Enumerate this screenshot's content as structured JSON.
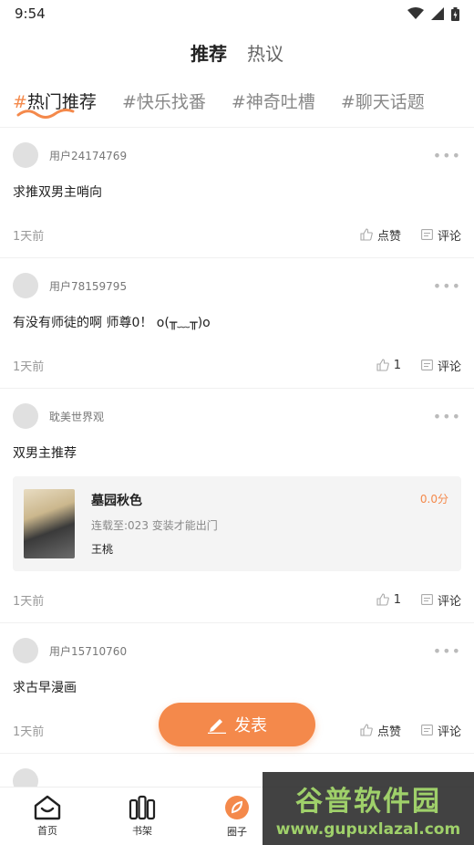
{
  "status_bar": {
    "time": "9:54"
  },
  "top_tabs": [
    "推荐",
    "热议"
  ],
  "topics": [
    {
      "hash": "#",
      "label": "热门推荐"
    },
    {
      "hash": "#",
      "label": "快乐找番"
    },
    {
      "hash": "#",
      "label": "神奇吐槽"
    },
    {
      "hash": "#",
      "label": "聊天话题"
    }
  ],
  "posts": [
    {
      "user": "用户24174769",
      "text": "求推双男主哨向",
      "time": "1天前",
      "like": "点赞",
      "comment": "评论"
    },
    {
      "user": "用户78159795",
      "text": "有没有师徒的啊 师尊0！ o(╥﹏╥)o",
      "time": "1天前",
      "like": "1",
      "comment": "评论"
    },
    {
      "user": "耽美世界观",
      "text": "双男主推荐",
      "time": "1天前",
      "like": "1",
      "comment": "评论",
      "book": {
        "title": "墓园秋色",
        "status": "连载至:023 变装才能出门",
        "author": "王桃",
        "score": "0.0分"
      }
    },
    {
      "user": "用户15710760",
      "text": "求古早漫画",
      "time": "1天前",
      "like": "点赞",
      "comment": "评论"
    }
  ],
  "publish_button": "发表",
  "bottom_nav": [
    "首页",
    "书架",
    "圈子"
  ],
  "watermark": {
    "text": "谷普软件园",
    "url": "www.gupuxlazal.com"
  },
  "colors": {
    "accent": "#f4894b"
  }
}
